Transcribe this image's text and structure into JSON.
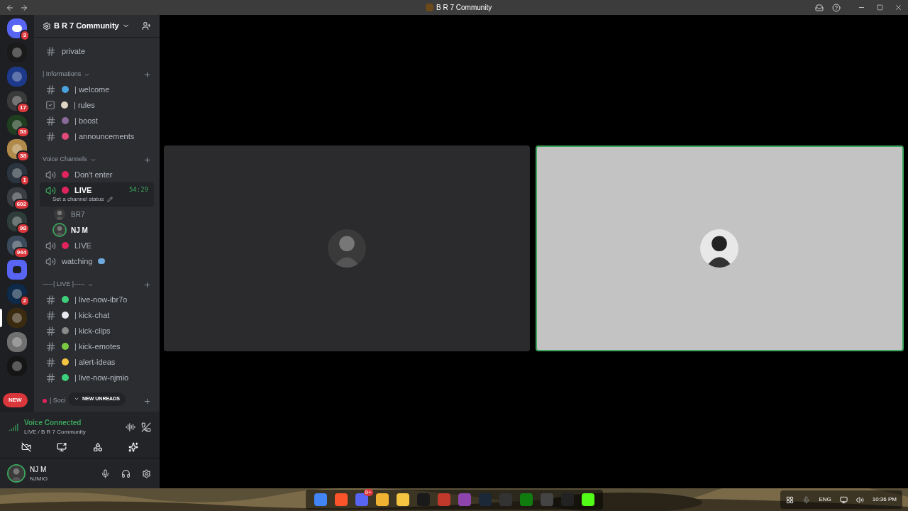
{
  "window": {
    "title": "B R 7 Community"
  },
  "servers": [
    {
      "badge": "3",
      "color": "#5865f2",
      "kind": "home",
      "selected": false
    },
    {
      "color": "#1a1a1a",
      "kind": "server",
      "selected": false
    },
    {
      "color": "#1d3a8a",
      "kind": "server",
      "selected": false
    },
    {
      "badge": "17",
      "color": "#3a3a3a",
      "kind": "server",
      "selected": false
    },
    {
      "badge": "53",
      "color": "#1f3d1f",
      "kind": "server",
      "selected": false
    },
    {
      "badge": "38",
      "color": "#b08a4a",
      "kind": "server",
      "selected": false
    },
    {
      "badge": "1",
      "color": "#2a3540",
      "kind": "server",
      "selected": false
    },
    {
      "badge": "602",
      "color": "#3a3d42",
      "kind": "server",
      "selected": false
    },
    {
      "badge": "98",
      "color": "#2e3d3a",
      "kind": "server",
      "selected": false
    },
    {
      "badge": "944",
      "color": "#3a4a5a",
      "kind": "server",
      "selected": false
    },
    {
      "color": "#5865f2",
      "kind": "folder",
      "selected": false
    },
    {
      "badge": "2",
      "color": "#0d2a4a",
      "kind": "server",
      "selected": false
    },
    {
      "color": "#3a2a10",
      "kind": "server",
      "selected": true
    },
    {
      "color": "#707070",
      "kind": "server",
      "selected": false
    },
    {
      "color": "#151515",
      "kind": "server",
      "selected": false
    }
  ],
  "new_pill": "NEW",
  "server_header": {
    "name": "B R 7 Community"
  },
  "sections": [
    {
      "channels": [
        {
          "kind": "text",
          "name": "private"
        }
      ]
    },
    {
      "title": "| Informations",
      "channels": [
        {
          "kind": "text",
          "name": "| welcome",
          "color": "#4aa3df"
        },
        {
          "kind": "rules",
          "name": "| rules",
          "color": "#e0d4c4"
        },
        {
          "kind": "text",
          "name": "| boost",
          "color": "#8a6a9a"
        },
        {
          "kind": "text",
          "name": "| announcements",
          "color": "#e24a7a"
        }
      ]
    },
    {
      "title": "Voice Channels",
      "channels": [
        {
          "kind": "voice",
          "name": "Don't enter",
          "color": "#e0245e",
          "selected": false
        },
        {
          "kind": "voice",
          "name": "LIVE",
          "color": "#e0245e",
          "selected": true,
          "timer": "54:29",
          "status": "Set a channel status",
          "members": [
            {
              "name": "BR7",
              "speaking": false
            },
            {
              "name": "NJ M",
              "speaking": true
            }
          ]
        },
        {
          "kind": "voice",
          "name": "LIVE",
          "color": "#e0245e",
          "selected": false
        },
        {
          "kind": "voice",
          "name": "watching",
          "selected": false
        }
      ]
    },
    {
      "title": "-----| LIVE |-----",
      "channels": [
        {
          "kind": "text",
          "name": "| live-now-ibr7o",
          "color": "#3ecf7a"
        },
        {
          "kind": "text",
          "name": "| kick-chat",
          "color": "#e8e8f0"
        },
        {
          "kind": "text",
          "name": "| kick-clips",
          "color": "#8a8a8a"
        },
        {
          "kind": "text",
          "name": "| kick-emotes",
          "color": "#7ac943"
        },
        {
          "kind": "text",
          "name": "| alert-ideas",
          "color": "#f5c542"
        },
        {
          "kind": "text",
          "name": "| live-now-njmio",
          "color": "#3ecf7a"
        }
      ]
    },
    {
      "title": "| Soci",
      "color": "#e0245e"
    }
  ],
  "unreads_pill": "NEW UNREADS",
  "voice_panel": {
    "title": "Voice Connected",
    "location": "LIVE / B R 7 Community"
  },
  "user": {
    "name": "NJ M",
    "status": "NJMIO"
  },
  "tiles": [
    {
      "speaking": false
    },
    {
      "speaking": true
    }
  ],
  "taskbar": {
    "apps": [
      {
        "color": "#4285f4"
      },
      {
        "color": "#fb542b"
      },
      {
        "color": "#5865f2",
        "badge": "9+"
      },
      {
        "color": "#f0b232"
      },
      {
        "color": "#f5c542"
      },
      {
        "color": "#1a1a1a"
      },
      {
        "color": "#c0392b"
      },
      {
        "color": "#8e44ad"
      },
      {
        "color": "#1b2838"
      },
      {
        "color": "#333333"
      },
      {
        "color": "#107c10"
      },
      {
        "color": "#444444"
      },
      {
        "color": "#222222"
      },
      {
        "color": "#53fc18"
      }
    ],
    "language": "ENG",
    "time": "10:36 PM"
  }
}
